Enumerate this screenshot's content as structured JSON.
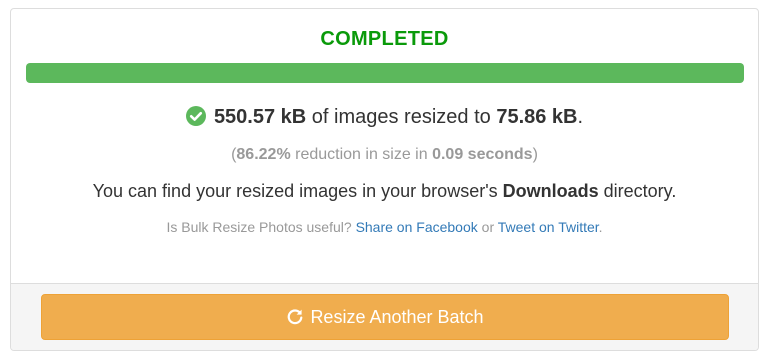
{
  "status": {
    "label": "COMPLETED",
    "color": "#0a9a0a"
  },
  "progress": {
    "percent": 100,
    "color": "#5cb85c"
  },
  "summary": {
    "icon": "check-circle-icon",
    "icon_color": "#5cb85c",
    "original_size": "550.57 kB",
    "middle_text": " of images resized to ",
    "new_size": "75.86 kB",
    "end": "."
  },
  "stats": {
    "open_paren": "(",
    "reduction": "86.22%",
    "middle": " reduction in size in ",
    "duration": "0.09 seconds",
    "close_paren": ")"
  },
  "downloads": {
    "prefix": "You can find your resized images in your browser's ",
    "bold": "Downloads",
    "suffix": " directory."
  },
  "share": {
    "question": "Is Bulk Resize Photos useful? ",
    "facebook_link": "Share on Facebook",
    "or": " or ",
    "twitter_link": "Tweet on Twitter",
    "end": "."
  },
  "button": {
    "icon": "refresh-icon",
    "label": "Resize Another Batch",
    "color": "#f0ad4e"
  }
}
